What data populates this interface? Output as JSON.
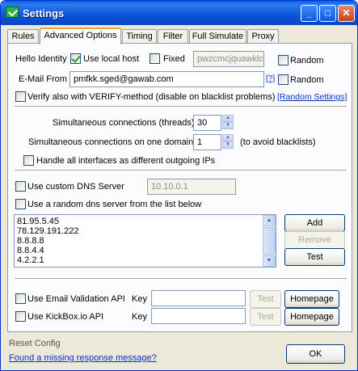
{
  "window": {
    "title": "Settings",
    "min": "_",
    "max": "□",
    "close": "✕"
  },
  "tabs": [
    {
      "label": "Rules"
    },
    {
      "label": "Advanced Options"
    },
    {
      "label": "Timing"
    },
    {
      "label": "Filter"
    },
    {
      "label": "Full Simulate"
    },
    {
      "label": "Proxy"
    }
  ],
  "identity": {
    "hello_label": "Hello Identity",
    "use_local_host_label": "Use local host",
    "use_local_host_checked": true,
    "fixed_label": "Fixed",
    "fixed_checked": false,
    "fixed_value": "pwzcmcjquawklc",
    "random1_label": "Random",
    "email_label": "E-Mail From",
    "email_value": "pmfkk.sged@gawab.com",
    "help_link": "[?]",
    "random2_label": "Random",
    "verify_label": "Verify also with VERIFY-method (disable on blacklist problems)",
    "random_settings_link": "[Random Settings]"
  },
  "connections": {
    "threads_label": "Simultaneous connections (threads)",
    "threads_value": "30",
    "domain_label": "Simultaneous connections on one domain",
    "domain_value": "1",
    "domain_hint": "(to avoid blacklists)",
    "handle_label": "Handle all interfaces as different outgoing IPs"
  },
  "dns": {
    "custom_label": "Use custom DNS Server",
    "custom_value": "10.10.0.1",
    "random_label": "Use a random dns server from the list below",
    "servers": [
      "81.95.5.45",
      "78.129.191.222",
      "8.8.8.8",
      "8.8.4.4",
      "4.2.2.1"
    ],
    "add_label": "Add",
    "remove_label": "Remove",
    "test_label": "Test"
  },
  "api": {
    "email_validation_label": "Use Email Validation API",
    "kickbox_label": "Use KickBox.io API",
    "key_label": "Key",
    "test_label": "Test",
    "homepage_label": "Homepage"
  },
  "footer": {
    "reset_label": "Reset Config",
    "missing_link": "Found a missing response message?",
    "ok_label": "OK"
  },
  "colors": {
    "titlebar": "#0a55d6",
    "tab_accent": "#f5a623",
    "link": "#0033cc"
  }
}
